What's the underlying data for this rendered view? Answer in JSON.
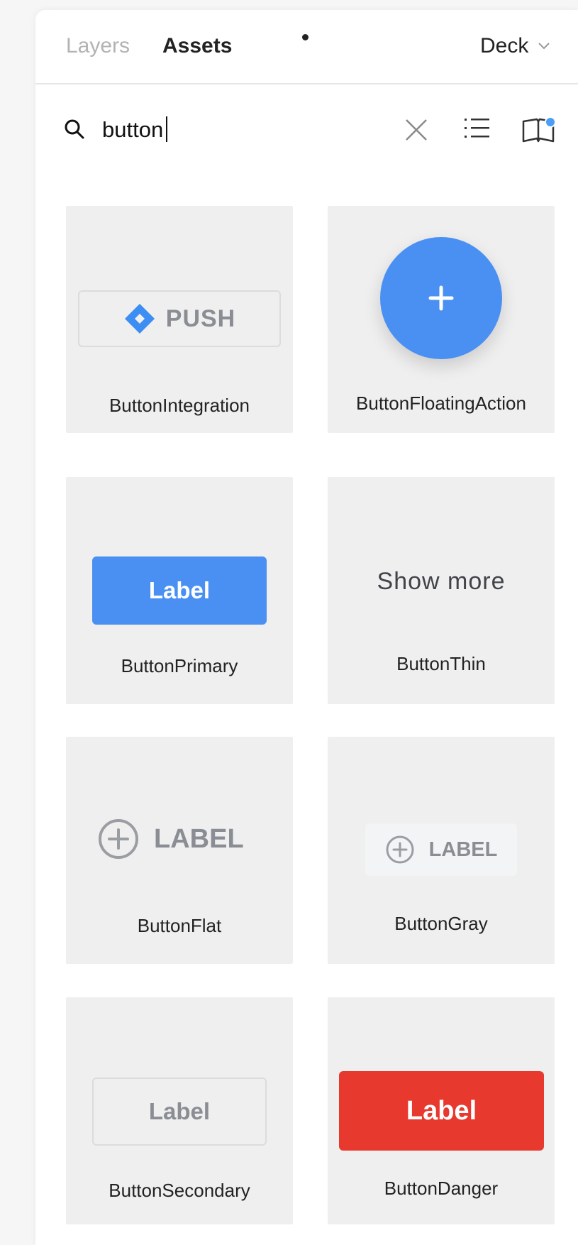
{
  "tabs": {
    "layers_label": "Layers",
    "assets_label": "Assets",
    "deck_label": "Deck"
  },
  "search": {
    "value": "button",
    "placeholder": ""
  },
  "icons": {
    "search": "search-icon",
    "clear": "close-icon",
    "list_view": "list-view-icon",
    "library": "library-book-icon",
    "library_badge_color": "#4a9ef5"
  },
  "assets": [
    {
      "name": "ButtonIntegration",
      "preview_text": "PUSH"
    },
    {
      "name": "ButtonFloatingAction",
      "preview_text": "+"
    },
    {
      "name": "ButtonPrimary",
      "preview_text": "Label"
    },
    {
      "name": "ButtonThin",
      "preview_text": "Show more"
    },
    {
      "name": "ButtonFlat",
      "preview_text": "LABEL"
    },
    {
      "name": "ButtonGray",
      "preview_text": "LABEL"
    },
    {
      "name": "ButtonSecondary",
      "preview_text": "Label"
    },
    {
      "name": "ButtonDanger",
      "preview_text": "Label"
    }
  ],
  "colors": {
    "primary": "#4a90f2",
    "danger": "#e8392f",
    "muted": "#8a8d93",
    "card_bg": "#efefef"
  }
}
